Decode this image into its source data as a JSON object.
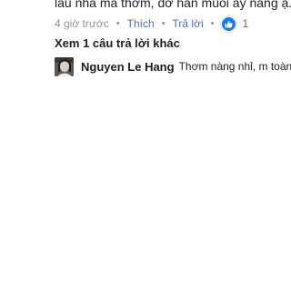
{
  "comment": {
    "text": "lau nhà mà thơm, đỡ hẳn muỗi ấy nàng ạ."
  },
  "meta": {
    "time": "4 giờ trước",
    "like_label": "Thích",
    "reply_label": "Trả lời",
    "like_count": "1",
    "like_icon": "thumbs-up-icon",
    "separator": "•"
  },
  "replies": {
    "view_more_label": "Xem 1 câu trả lời khác",
    "latest": {
      "author": "Nguyen Le Hang",
      "preview": "Thơm nàng nhỉ, m toàn..."
    }
  },
  "colors": {
    "link": "#4b6fa8",
    "muted": "#8d949e",
    "like_blue": "#1877f2",
    "text": "#1c1e21"
  }
}
